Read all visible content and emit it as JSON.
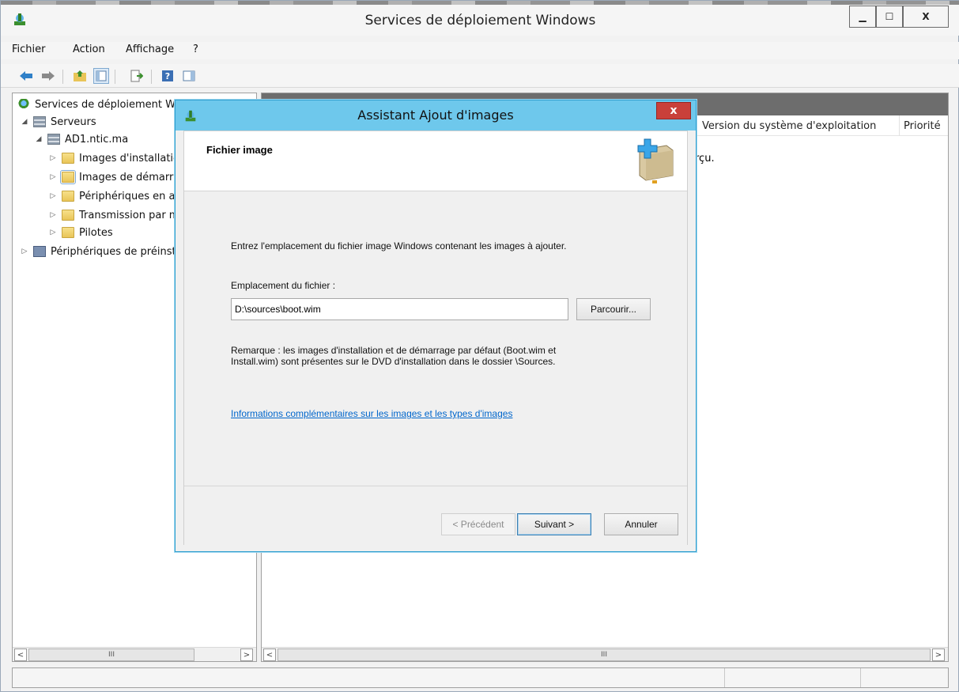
{
  "window": {
    "title": "Services de déploiement Windows",
    "minimize_glyph": "▁",
    "maximize_glyph": "☐",
    "close_glyph": "X"
  },
  "menu": [
    "Fichier",
    "Action",
    "Affichage",
    "?"
  ],
  "toolbar_icons": [
    "back-arrow-icon",
    "forward-arrow-icon",
    "up-folder-icon",
    "show-hide-tree-icon",
    "export-list-icon",
    "help-icon",
    "action-pane-icon"
  ],
  "tree": {
    "root": "Services de déploiement Windows",
    "servers": "Serveurs",
    "server": "AD1.ntic.ma",
    "children": [
      "Images d'installation",
      "Images de démarrage",
      "Périphériques en attente",
      "Transmission par multidiffusion",
      "Pilotes"
    ],
    "prestaged": "Périphériques de préinstallation"
  },
  "right_pane": {
    "columns": [
      "Version du système d'exploitation",
      "Priorité"
    ],
    "message": "rçu."
  },
  "scrollbar_thumb_glyph": "III",
  "dialog": {
    "title": "Assistant Ajout d'images",
    "close_glyph": "x",
    "heading": "Fichier image",
    "instruction": "Entrez l'emplacement du fichier image Windows contenant les images à ajouter.",
    "location_label": "Emplacement du fichier :",
    "location_value": "D:\\sources\\boot.wim",
    "browse": "Parcourir...",
    "note_line1": "Remarque : les images d'installation et de démarrage par défaut (Boot.wim et",
    "note_line2": "Install.wim) sont présentes sur le DVD d'installation dans le dossier \\Sources.",
    "link": "Informations complémentaires sur les images et les types d'images",
    "prev": "< Précédent",
    "next": "Suivant >",
    "cancel": "Annuler"
  },
  "colors": {
    "dialog_titlebar": "#6ec8ec",
    "dialog_close": "#c9403a",
    "link": "#0066cc",
    "right_header": "#6d6d6d"
  }
}
